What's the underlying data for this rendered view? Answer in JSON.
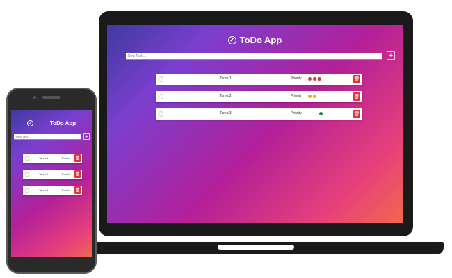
{
  "app": {
    "title": "ToDo App",
    "input_placeholder": "New Task...",
    "add_symbol": "+",
    "check_symbol": "✓",
    "trash_symbol": "🗑",
    "icons": {
      "title": "check-circle-icon",
      "add": "plus-icon",
      "delete": "trash-icon"
    }
  },
  "colors": {
    "priority_high": "#e0323c",
    "priority_medium": "#f5a623",
    "priority_low": "#1e8a4c",
    "delete_button": "#e0323c",
    "input_underline": "#4aa3e8"
  },
  "tasks": [
    {
      "name": "Tarea 1",
      "priority_label": "Priority:",
      "priority_level": "high",
      "dots": 3
    },
    {
      "name": "Tarea 2",
      "priority_label": "Priority:",
      "priority_level": "medium",
      "dots": 2
    },
    {
      "name": "Tarea 3",
      "priority_label": "Priority:",
      "priority_level": "low",
      "dots": 1
    }
  ]
}
